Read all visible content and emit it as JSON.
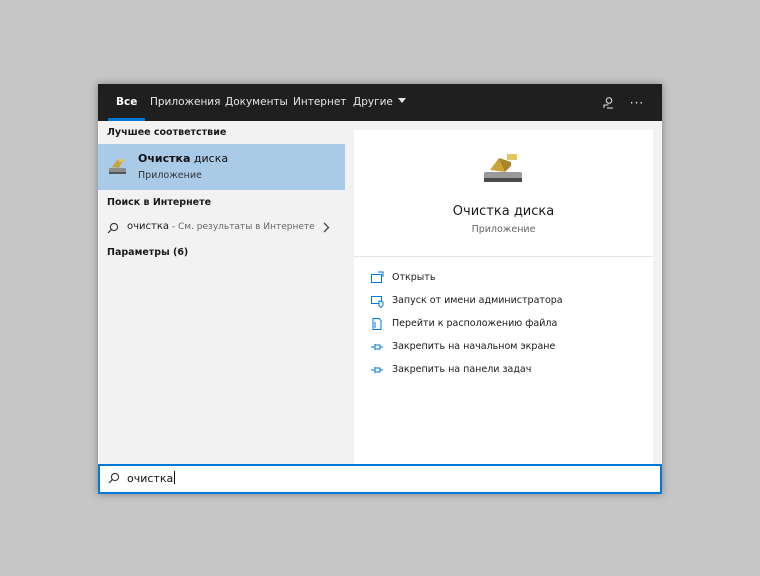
{
  "tabs": [
    {
      "label": "Все",
      "active": true
    },
    {
      "label": "Приложения"
    },
    {
      "label": "Документы"
    },
    {
      "label": "Интернет"
    },
    {
      "label": "Другие"
    }
  ],
  "topbar_icons": [
    "feedback-icon",
    "more-options-icon"
  ],
  "left": {
    "best_match_title": "Лучшее соответствие",
    "best_match": {
      "name_bold": "Очистка",
      "name_rest": " диска",
      "subtitle": "Приложение"
    },
    "web_title": "Поиск в Интернете",
    "web_query": "очистка",
    "web_hint": " - См. результаты в Интернете",
    "settings_title": "Параметры (6)"
  },
  "right": {
    "app_name": "Очистка диска",
    "app_type": "Приложение",
    "actions": [
      {
        "label": "Открыть",
        "icon": "open-icon"
      },
      {
        "label": "Запуск от имени администратора",
        "icon": "run-as-admin-icon"
      },
      {
        "label": "Перейти к расположению файла",
        "icon": "file-location-icon"
      },
      {
        "label": "Закрепить на начальном экране",
        "icon": "pin-icon"
      },
      {
        "label": "Закрепить на панели задач",
        "icon": "pin-icon"
      }
    ]
  },
  "search": {
    "value": "очистка"
  },
  "colors": {
    "accent": "#0078d7",
    "selected": "#aacbe8",
    "topbar": "#1f1f1f"
  }
}
